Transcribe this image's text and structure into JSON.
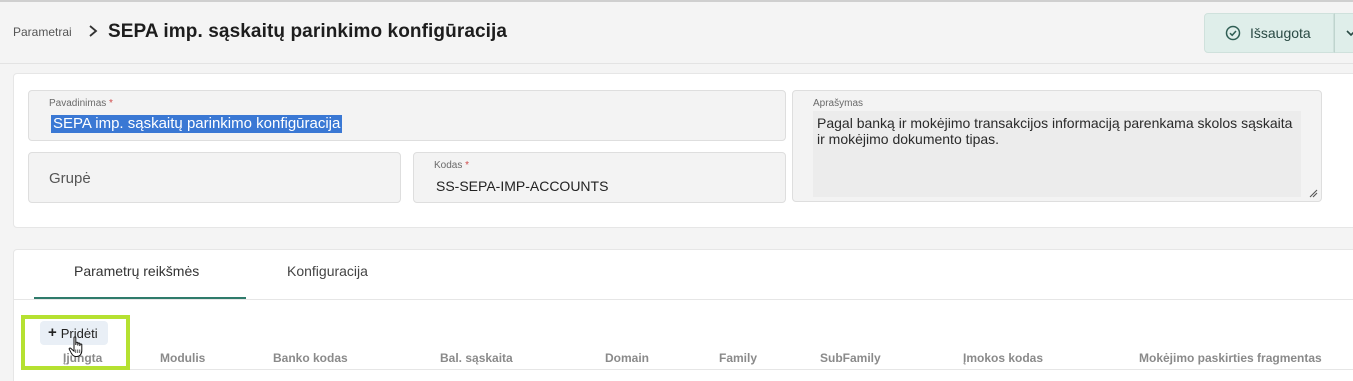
{
  "breadcrumb": {
    "parent": "Parametrai"
  },
  "page": {
    "title": "SEPA imp. sąskaitų parinkimo konfigūracija"
  },
  "header": {
    "saved_label": "Išsaugota"
  },
  "form": {
    "name_label": "Pavadinimas",
    "name_value": "SEPA imp. sąskaitų parinkimo konfigūracija",
    "group_placeholder": "Grupė",
    "code_label": "Kodas",
    "code_value": "SS-SEPA-IMP-ACCOUNTS",
    "description_label": "Aprašymas",
    "description_value": "Pagal banką ir mokėjimo transakcijos informaciją parenkama skolos sąskaita ir mokėjimo dokumento tipas.",
    "required_mark": "*"
  },
  "tabs": [
    {
      "label": "Parametrų reikšmės",
      "active": true
    },
    {
      "label": "Konfiguracija",
      "active": false
    }
  ],
  "table": {
    "add_label": "Pridėti",
    "columns": [
      "Įjungta",
      "Modulis",
      "Banko kodas",
      "Bal. sąskaita",
      "Domain",
      "Family",
      "SubFamily",
      "Įmokos kodas",
      "Mokėjimo paskirties fragmentas"
    ]
  },
  "colors": {
    "accent": "#2f7b6b",
    "selection": "#3a78d4",
    "highlight": "#b5e131",
    "saved_bg": "#dfeeea"
  },
  "icons": {
    "saved": "check-circle-icon",
    "breadcrumb_separator": "chevron-right-icon",
    "menu": "chevron-down-icon",
    "add": "plus-icon",
    "resize": "resize-handle-icon",
    "cursor": "hand-cursor-icon"
  }
}
